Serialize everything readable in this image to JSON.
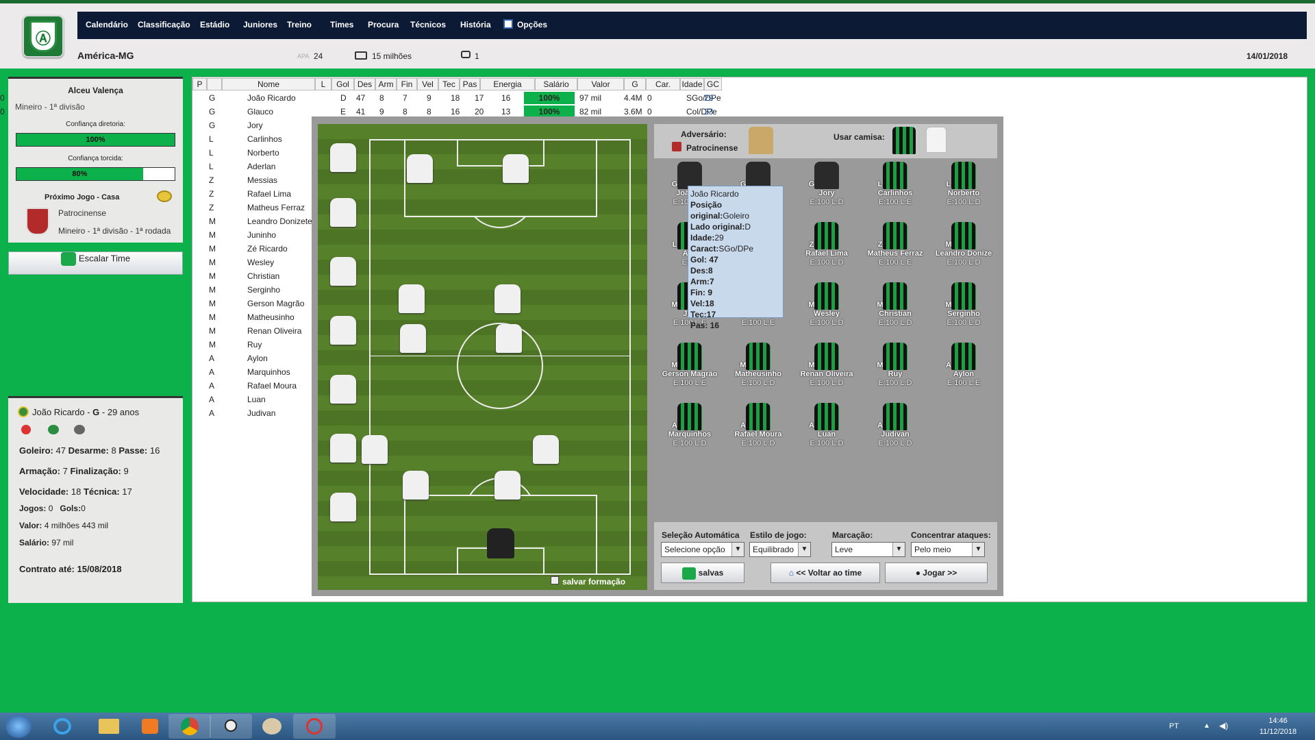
{
  "header": {
    "club_name": "América-MG",
    "logo_text": "Ⓐ",
    "stat_1_icon": "APA",
    "stat_1": "24",
    "stat_2": "15 milhões",
    "stat_3": "1",
    "date": "14/01/2018",
    "nav": [
      "Calendário",
      "Classificação",
      "Estádio",
      "Juniores",
      "Treino",
      "Times",
      "Procura",
      "Técnicos",
      "História",
      "Opções"
    ]
  },
  "coach": {
    "name": "Alceu Valença",
    "league": "Mineiro - 1ª divisão",
    "board_label": "Confiança diretoria:",
    "board_value": "100%",
    "board_level": 1.0,
    "fans_label": "Confiança torcida:",
    "fans_value": "80%",
    "fans_level": 0.8,
    "next_game_label": "Próximo Jogo - Casa",
    "opponent": "Patrocinense",
    "competition": "Mineiro - 1ª divisão - 1ª rodada"
  },
  "escalar_button": "Escalar Time",
  "player_card": {
    "name": "João Ricardo",
    "pos": "G",
    "age": "29 anos",
    "l1a": "Goleiro:",
    "v1a": "47",
    "l1b": "Desarme:",
    "v1b": "8",
    "l1c": "Passe:",
    "v1c": "16",
    "l2a": "Armação:",
    "v2a": "7",
    "l2b": "Finalização:",
    "v2b": "9",
    "l3a": "Velocidade:",
    "v3a": "18",
    "l3b": "Técnica:",
    "v3b": "17",
    "l4a": "Jogos:",
    "v4a": "0",
    "l4b": "Gols:",
    "v4b": "0",
    "l5": "Valor:",
    "v5": "4 milhões 443 mil",
    "l6": "Salário:",
    "v6": "97 mil",
    "l7": "Contrato até:",
    "v7": "15/08/2018"
  },
  "table": {
    "headers": [
      "P",
      "",
      "Nome",
      "L",
      "Gol",
      "Des",
      "Arm",
      "Fin",
      "Vel",
      "Tec",
      "Pas",
      "Energia",
      "Salário",
      "Valor",
      "G",
      "Car.",
      "Idade",
      "GC"
    ],
    "rows": [
      [
        "G",
        "João Ricardo",
        "D",
        "47",
        "8",
        "7",
        "9",
        "18",
        "17",
        "16",
        "100%",
        "97 mil",
        "4.4M",
        "0",
        "SGo/DPe",
        "29",
        "0"
      ],
      [
        "G",
        "Glauco",
        "E",
        "41",
        "9",
        "8",
        "8",
        "16",
        "20",
        "13",
        "100%",
        "82 mil",
        "3.6M",
        "0",
        "Col/DPe",
        "23",
        "0"
      ]
    ],
    "list": [
      [
        "G",
        "Jory"
      ],
      [
        "L",
        "Carlinhos"
      ],
      [
        "L",
        "Norberto"
      ],
      [
        "L",
        "Aderlan"
      ],
      [
        "Z",
        "Messias"
      ],
      [
        "Z",
        "Rafael Lima"
      ],
      [
        "Z",
        "Matheus Ferraz"
      ],
      [
        "M",
        "Leandro Donizete"
      ],
      [
        "M",
        "Juninho"
      ],
      [
        "M",
        "Zé Ricardo"
      ],
      [
        "M",
        "Wesley"
      ],
      [
        "M",
        "Christian"
      ],
      [
        "M",
        "Serginho"
      ],
      [
        "M",
        "Gerson Magrão"
      ],
      [
        "M",
        "Matheusinho"
      ],
      [
        "M",
        "Renan Oliveira"
      ],
      [
        "M",
        "Ruy"
      ],
      [
        "A",
        "Aylon"
      ],
      [
        "A",
        "Marquinhos"
      ],
      [
        "A",
        "Rafael Moura"
      ],
      [
        "A",
        "Luan"
      ],
      [
        "A",
        "Judivan"
      ]
    ]
  },
  "modal": {
    "adversario_label": "Adversário:",
    "adversario": "Patrocinense",
    "usar_camisa": "Usar camisa:",
    "salvar_formacao": "salvar formação",
    "squad": [
      {
        "pos": "G",
        "name": "João R.",
        "stat": "E:100 L:D",
        "kit": "black"
      },
      {
        "pos": "G",
        "name": "",
        "stat": "",
        "kit": "black"
      },
      {
        "pos": "G",
        "name": "Jory",
        "stat": "E:100 L:D",
        "kit": "black"
      },
      {
        "pos": "L",
        "name": "Carlinhos",
        "stat": "E:100 L:E",
        "kit": "green"
      },
      {
        "pos": "L",
        "name": "Norberto",
        "stat": "E:100 L:D",
        "kit": "green"
      },
      {
        "pos": "L",
        "name": "Ade",
        "stat": "E:10",
        "kit": "green"
      },
      {
        "pos": "",
        "name": "",
        "stat": "",
        "kit": "none"
      },
      {
        "pos": "Z",
        "name": "Rafael Lima",
        "stat": "E:100 L:D",
        "kit": "green"
      },
      {
        "pos": "Z",
        "name": "Matheus Ferraz",
        "stat": "E:100 L:E",
        "kit": "green"
      },
      {
        "pos": "M",
        "name": "Leandro Donize",
        "stat": "E:100 L:D",
        "kit": "green"
      },
      {
        "pos": "M",
        "name": "Jun",
        "stat": "E:100 L:E",
        "kit": "green"
      },
      {
        "pos": "",
        "name": "",
        "stat": "E:100 L:E",
        "kit": "none"
      },
      {
        "pos": "M",
        "name": "Wesley",
        "stat": "E:100 L:D",
        "kit": "green"
      },
      {
        "pos": "M",
        "name": "Christian",
        "stat": "E:100 L:D",
        "kit": "green"
      },
      {
        "pos": "M",
        "name": "Serginho",
        "stat": "E:100 L:D",
        "kit": "green"
      },
      {
        "pos": "M",
        "name": "Gerson Magrão",
        "stat": "E:100 L:E",
        "kit": "green"
      },
      {
        "pos": "M",
        "name": "Matheusinho",
        "stat": "E:100 L:D",
        "kit": "green"
      },
      {
        "pos": "M",
        "name": "Renan Oliveira",
        "stat": "E:100 L:D",
        "kit": "green"
      },
      {
        "pos": "M",
        "name": "Ruy",
        "stat": "E:100 L:D",
        "kit": "green"
      },
      {
        "pos": "A",
        "name": "Aylon",
        "stat": "E:100 L:E",
        "kit": "green"
      },
      {
        "pos": "A",
        "name": "Marquinhos",
        "stat": "E:100 L:D",
        "kit": "green"
      },
      {
        "pos": "A",
        "name": "Rafael Moura",
        "stat": "E:100 L:D",
        "kit": "green"
      },
      {
        "pos": "A",
        "name": "Luan",
        "stat": "E:100 L:D",
        "kit": "green"
      },
      {
        "pos": "A",
        "name": "Judivan",
        "stat": "E:100 L:D",
        "kit": "green"
      }
    ],
    "tooltip": {
      "name": "João Ricardo",
      "l1": "Posição original:",
      "v1": "Goleiro",
      "l2": "Lado original:",
      "v2": "D",
      "l3": "Idade:",
      "v3": "29",
      "l4": "Caract:",
      "v4": "SGo/DPe",
      "l5": "Gol:",
      "v5": "47",
      "l6": "Des:",
      "v6": "8",
      "l7": "Arm:",
      "v7": "7",
      "l8": "Fin:",
      "v8": "9",
      "l9": "Vel:",
      "v9": "18",
      "l10": "Tec:",
      "v10": "17",
      "l11": "Pas:",
      "v11": "16"
    },
    "controls": {
      "auto_label": "Seleção Automática",
      "auto_value": "Selecione opção",
      "style_label": "Estilo de jogo:",
      "style_value": "Equilibrado",
      "marking_label": "Marcação:",
      "marking_value": "Leve",
      "attack_label": "Concentrar ataques:",
      "attack_value": "Pelo meio",
      "salvas": "salvas",
      "voltar": "<< Voltar ao time",
      "jogar": "Jogar >>"
    }
  },
  "taskbar": {
    "lang": "PT",
    "time": "14:46",
    "date": "11/12/2018"
  },
  "colors": {
    "accent": "#0db14b",
    "nav": "#0c1a36",
    "pitch": "#57802a",
    "tooltip": "#c9d9ec"
  }
}
